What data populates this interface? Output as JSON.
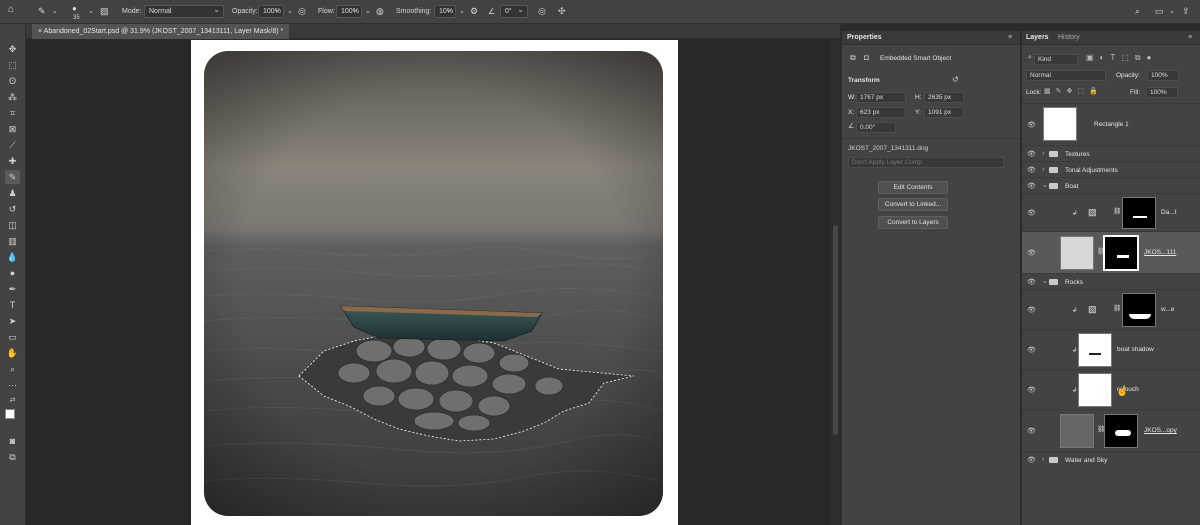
{
  "options_bar": {
    "brush_size": "35",
    "mode_label": "Mode:",
    "mode_value": "Normal",
    "opacity_label": "Opacity:",
    "opacity_value": "100%",
    "flow_label": "Flow:",
    "flow_value": "100%",
    "smoothing_label": "Smoothing:",
    "smoothing_value": "10%",
    "angle_value": "0°"
  },
  "document_tab": {
    "title": "Abandoned_02Start.psd @ 31.9% (JKOST_2007_13413111, Layer Mask/8) *"
  },
  "properties": {
    "tab": "Properties",
    "type": "Embedded Smart Object",
    "section": "Transform",
    "w_label": "W:",
    "w_value": "1767 px",
    "h_label": "H:",
    "h_value": "2635 px",
    "x_label": "X:",
    "x_value": "623 px",
    "y_label": "Y:",
    "y_value": "1091 px",
    "angle_value": "0.00°",
    "filename": "JKOST_2007_1341311.dng",
    "layer_comp": "Don't Apply Layer Comp",
    "buttons": [
      "Edit Contents",
      "Convert to Linked...",
      "Convert to Layers"
    ]
  },
  "layers": {
    "tab_layers": "Layers",
    "tab_history": "History",
    "kind": "Kind",
    "blend_mode": "Normal",
    "opacity_label": "Opacity:",
    "opacity_value": "100%",
    "lock_label": "Lock:",
    "fill_label": "Fill:",
    "fill_value": "100%",
    "items": [
      "Rectangle 1",
      "Textures",
      "Tonal Adjustments",
      "Boat",
      "Da...t",
      "JKOS...111",
      "Rocks",
      "w...e",
      "boat shadow",
      "retouch",
      "JKOS...opy",
      "Water and Sky"
    ]
  },
  "colors": {
    "panel_bg": "#434343",
    "selected_layer": "#595959",
    "accent_link": "#7aa6ff"
  }
}
